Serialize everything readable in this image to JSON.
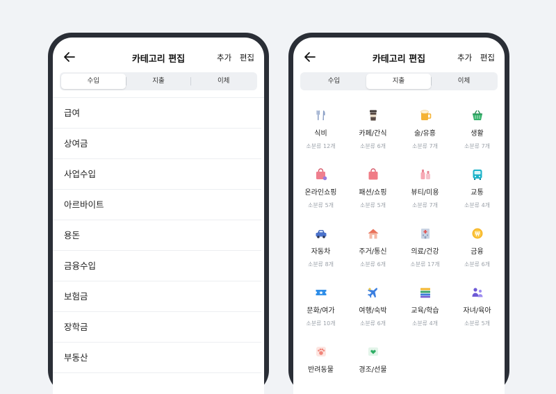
{
  "left_screen": {
    "title": "카테고리 편집",
    "add_label": "추가",
    "edit_label": "편집",
    "tabs": [
      "수입",
      "지출",
      "이체"
    ],
    "active_tab": "수입",
    "items": [
      "급여",
      "상여금",
      "사업수입",
      "아르바이트",
      "용돈",
      "금융수입",
      "보험금",
      "장학금",
      "부동산"
    ]
  },
  "right_screen": {
    "title": "카테고리 편집",
    "add_label": "추가",
    "edit_label": "편집",
    "tabs": [
      "수입",
      "지출",
      "이체"
    ],
    "active_tab": "지출",
    "categories": [
      {
        "name": "식비",
        "sub": "소분류 12개",
        "icon": "fork-knife-icon"
      },
      {
        "name": "카페/간식",
        "sub": "소분류 6개",
        "icon": "coffee-cup-icon"
      },
      {
        "name": "술/유흥",
        "sub": "소분류 7개",
        "icon": "beer-mug-icon"
      },
      {
        "name": "생활",
        "sub": "소분류 7개",
        "icon": "basket-icon"
      },
      {
        "name": "온라인쇼핑",
        "sub": "소분류 5개",
        "icon": "shopping-bag-online-icon"
      },
      {
        "name": "패션/쇼핑",
        "sub": "소분류 5개",
        "icon": "shopping-bag-icon"
      },
      {
        "name": "뷰티/미용",
        "sub": "소분류 7개",
        "icon": "cosmetics-icon"
      },
      {
        "name": "교통",
        "sub": "소분류 4개",
        "icon": "bus-icon"
      },
      {
        "name": "자동차",
        "sub": "소분류 8개",
        "icon": "car-icon"
      },
      {
        "name": "주거/통신",
        "sub": "소분류 6개",
        "icon": "house-icon"
      },
      {
        "name": "의료/건강",
        "sub": "소분류 17개",
        "icon": "hospital-icon"
      },
      {
        "name": "금융",
        "sub": "소분류 6개",
        "icon": "won-coin-icon"
      },
      {
        "name": "문화/여가",
        "sub": "소분류 10개",
        "icon": "ticket-icon"
      },
      {
        "name": "여행/숙박",
        "sub": "소분류 6개",
        "icon": "airplane-icon"
      },
      {
        "name": "교육/학습",
        "sub": "소분류 4개",
        "icon": "books-icon"
      },
      {
        "name": "자녀/육아",
        "sub": "소분류 5개",
        "icon": "family-icon"
      },
      {
        "name": "반려동물",
        "sub": "",
        "icon": "paw-icon"
      },
      {
        "name": "경조/선물",
        "sub": "",
        "icon": "gift-card-icon"
      }
    ]
  }
}
